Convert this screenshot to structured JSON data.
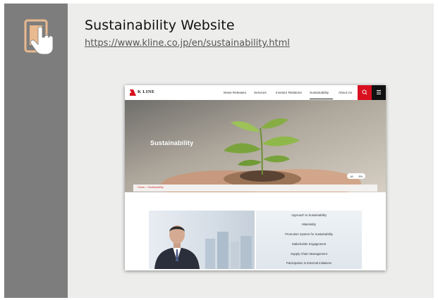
{
  "card": {
    "title": "Sustainability Website",
    "url": "https://www.kline.co.jp/en/sustainability.html",
    "icon": "tablet-touch-icon"
  },
  "website": {
    "logo": "K LINE",
    "nav": [
      "News Releases",
      "Services",
      "Investor Relations",
      "Sustainability",
      "About Us"
    ],
    "hero_title": "Sustainability",
    "lang": [
      "JA",
      "EN"
    ],
    "breadcrumb": "Home > Sustainability",
    "menu": [
      "Approach to Sustainability",
      "Materiality",
      "Promotion System for Sustainability",
      "Stakeholder Engagement",
      "Supply Chain Management",
      "Participation in External Initiatives"
    ],
    "colors": {
      "accent": "#d8101f",
      "dark": "#111111"
    }
  }
}
